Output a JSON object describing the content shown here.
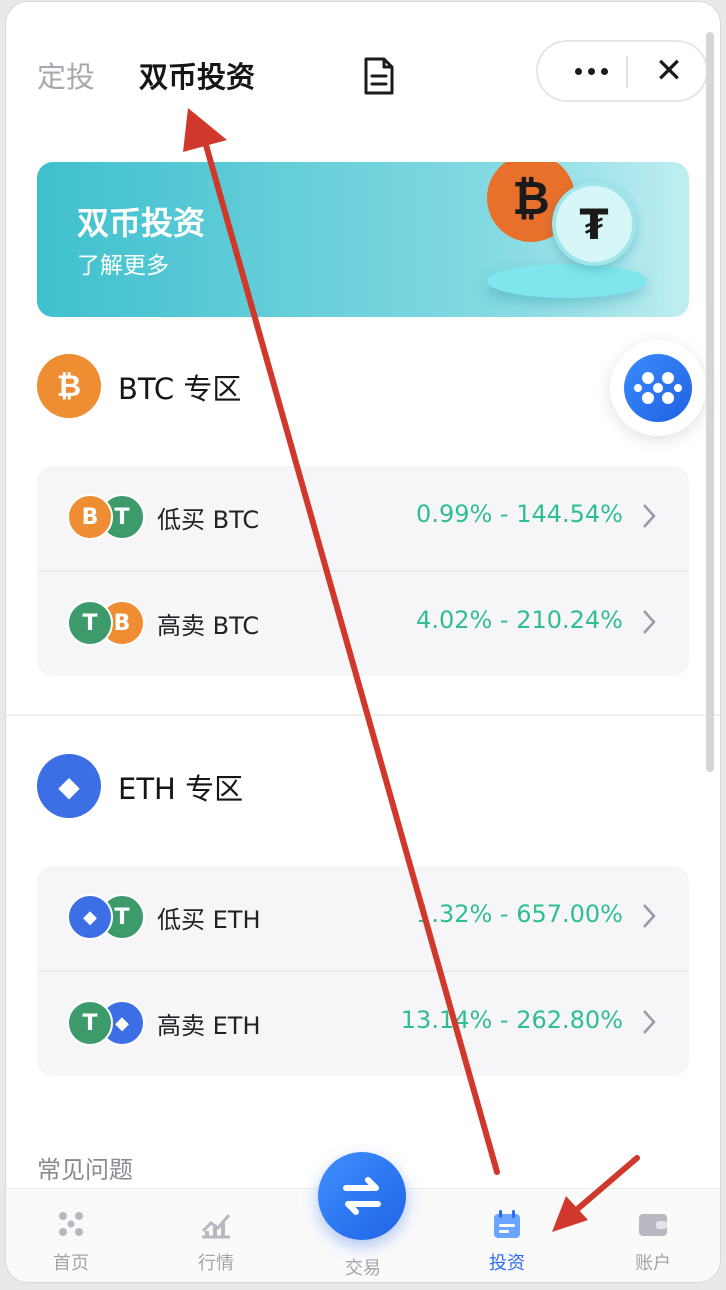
{
  "header": {
    "tab_regular": "定投",
    "tab_dual": "双币投资",
    "more_icon": "more-icon",
    "close_label": "✕"
  },
  "banner": {
    "title": "双币投资",
    "link": "了解更多",
    "btc_glyph": "₿",
    "usdt_glyph": "₮"
  },
  "btc_zone": {
    "icon_glyph": "₿",
    "title": "BTC 专区",
    "rows": [
      {
        "label": "低买 BTC",
        "range": "0.99% - 144.54%"
      },
      {
        "label": "高卖 BTC",
        "range": "4.02% - 210.24%"
      }
    ]
  },
  "eth_zone": {
    "icon_glyph": "◆",
    "title": "ETH 专区",
    "rows": [
      {
        "label": "低买 ETH",
        "range": "1.32% - 657.00%"
      },
      {
        "label": "高卖 ETH",
        "range": "13.14% - 262.80%"
      }
    ]
  },
  "coin_glyphs": {
    "btc": "B",
    "usdt": "T",
    "eth": "◆"
  },
  "faq": {
    "title": "常见问题"
  },
  "nav": {
    "home": "首页",
    "market": "行情",
    "trade": "交易",
    "invest": "投资",
    "account": "账户"
  },
  "colors": {
    "accent": "#2b6cf5",
    "btc": "#ef8d32",
    "usdt": "#3d9a6b",
    "eth": "#3c6fe6",
    "positive": "#2fbf8e",
    "annotation": "#d0382b"
  }
}
